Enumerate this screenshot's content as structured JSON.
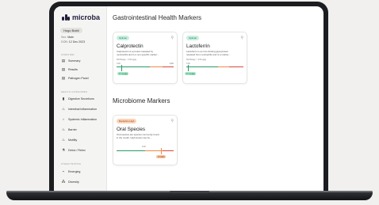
{
  "brand": {
    "name": "microba"
  },
  "patient": {
    "name": "Hugo Babil",
    "sex_label": "Sex:",
    "sex": "Male",
    "dob_label": "DOB:",
    "dob": "12 Dec 2023"
  },
  "sections": {
    "overview": "OVERVIEW",
    "health": "HEALTH CATEGORIES",
    "other": "OTHER TESTING"
  },
  "nav": {
    "overview": [
      {
        "label": "Summary",
        "icon": "document-icon"
      },
      {
        "label": "Results",
        "icon": "document-icon"
      },
      {
        "label": "Pathogen Panel",
        "icon": "document-icon"
      }
    ],
    "health": [
      {
        "label": "Digestive Secretions",
        "icon": "digestive-icon"
      },
      {
        "label": "Intestinal Inflammation",
        "icon": "fire-icon"
      },
      {
        "label": "Systemic Inflammation",
        "icon": "systemic-icon"
      },
      {
        "label": "Barrier",
        "icon": "barrier-icon"
      },
      {
        "label": "Motility",
        "icon": "motility-icon"
      },
      {
        "label": "Detox / Retox",
        "icon": "detox-icon"
      }
    ],
    "other": [
      {
        "label": "Emerging",
        "icon": "emerging-icon"
      },
      {
        "label": "Diversity",
        "icon": "diversity-icon"
      }
    ]
  },
  "main": {
    "gi_heading": "Gastrointestinal Health Markers",
    "microbiome_heading": "Microbiome Markers",
    "cards": [
      {
        "status": "Optimal",
        "title": "Calprotectin",
        "desc_line1": "Calprotectin is a protein released by",
        "desc_line2": "neutrophils and is a non-specific marker...",
        "ref": "Ref Range: > 0.00 µg/g",
        "scale_min": "0.00",
        "scale_max": "1000",
        "value": "17.1 µg/g",
        "marker_fraction": 0.05
      },
      {
        "status": "Optimal",
        "title": "Lactoferrin",
        "desc_line1": "Lactoferrin is an iron-binding glycoprotein",
        "desc_line2": "released from neutrophils and is a marker...",
        "ref": "Ref Range: > 0.00 µg/g",
        "scale_min": "0.00",
        "scale_max": "",
        "value": "17.1 µg/g",
        "marker_fraction": 0.0
      },
      {
        "status": "Borderline High",
        "title": "Oral Species",
        "desc_line1": "Oral species are species commonly found",
        "desc_line2": "in the mouth. High levels may be...",
        "scale_mid": "9.00",
        "value": "27.00%",
        "marker_fraction": 0.75
      }
    ]
  },
  "colors": {
    "accent_dark": "#221c3c",
    "optimal": "#2a9a6a",
    "borderline": "#f08a4b",
    "high": "#d9473b"
  }
}
